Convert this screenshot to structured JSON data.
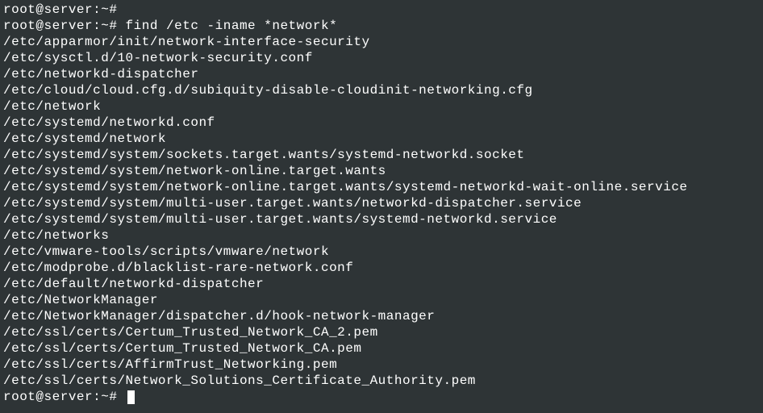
{
  "prompt1": "root@server:~#",
  "prompt2_full": "root@server:~# find /etc -iname *network*",
  "output_lines": [
    "/etc/apparmor/init/network-interface-security",
    "/etc/sysctl.d/10-network-security.conf",
    "/etc/networkd-dispatcher",
    "/etc/cloud/cloud.cfg.d/subiquity-disable-cloudinit-networking.cfg",
    "/etc/network",
    "/etc/systemd/networkd.conf",
    "/etc/systemd/network",
    "/etc/systemd/system/sockets.target.wants/systemd-networkd.socket",
    "/etc/systemd/system/network-online.target.wants",
    "/etc/systemd/system/network-online.target.wants/systemd-networkd-wait-online.service",
    "/etc/systemd/system/multi-user.target.wants/networkd-dispatcher.service",
    "/etc/systemd/system/multi-user.target.wants/systemd-networkd.service",
    "/etc/networks",
    "/etc/vmware-tools/scripts/vmware/network",
    "/etc/modprobe.d/blacklist-rare-network.conf",
    "/etc/default/networkd-dispatcher",
    "/etc/NetworkManager",
    "/etc/NetworkManager/dispatcher.d/hook-network-manager",
    "/etc/ssl/certs/Certum_Trusted_Network_CA_2.pem",
    "/etc/ssl/certs/Certum_Trusted_Network_CA.pem",
    "/etc/ssl/certs/AffirmTrust_Networking.pem",
    "/etc/ssl/certs/Network_Solutions_Certificate_Authority.pem"
  ],
  "prompt3": "root@server:~# "
}
